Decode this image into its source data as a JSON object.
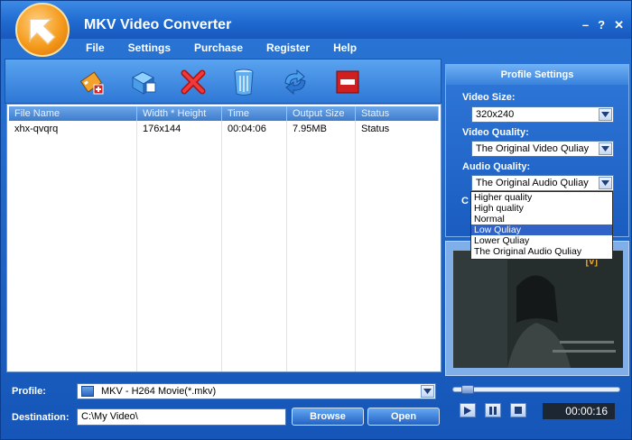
{
  "window": {
    "title": "MKV Video Converter",
    "controls": [
      "–",
      "?",
      "✕"
    ]
  },
  "menu": [
    "File",
    "Settings",
    "Purchase",
    "Register",
    "Help"
  ],
  "toolbar": {
    "icons": [
      "add-video-icon",
      "add-folder-icon",
      "delete-icon",
      "clear-icon",
      "convert-icon",
      "stop-icon"
    ]
  },
  "filelist": {
    "columns": [
      "File Name",
      "Width * Height",
      "Time",
      "Output Size",
      "Status"
    ],
    "rows": [
      [
        "xhx-qvqrq",
        "176x144",
        "00:04:06",
        "7.95MB",
        "Status"
      ]
    ]
  },
  "profile": {
    "label": "Profile:",
    "value": "MKV - H264 Movie(*.mkv)"
  },
  "destination": {
    "label": "Destination:",
    "value": "C:\\My Video\\",
    "browse": "Browse",
    "open": "Open"
  },
  "settings": {
    "header": "Profile Settings",
    "video_size_label": "Video Size:",
    "video_size": "320x240",
    "video_quality_label": "Video Quality:",
    "video_quality": "The Original Video Quliay",
    "audio_quality_label": "Audio Quality:",
    "audio_quality": "The Original Audio Quliay",
    "audio_options": [
      "Higher quality",
      "High quality",
      "Normal",
      "Low Quliay",
      "Lower Quliay",
      "The Original Audio Quliay"
    ],
    "audio_selected_index": 3,
    "cutoff_label": "C"
  },
  "player": {
    "time": "00:00:16",
    "seek_fraction": 0.05,
    "watermark": "[v]"
  },
  "colors": {
    "accent": "#1f6ad0",
    "selection": "#3163c6"
  }
}
